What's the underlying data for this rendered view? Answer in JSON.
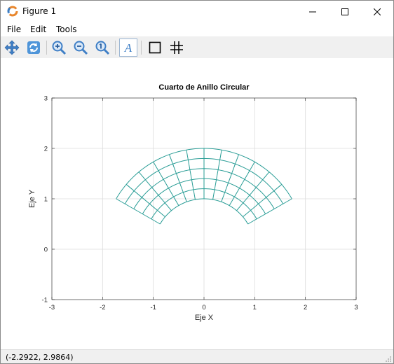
{
  "window": {
    "title": "Figure 1"
  },
  "menu": {
    "items": [
      "File",
      "Edit",
      "Tools"
    ]
  },
  "toolbar": {
    "buttons": [
      "pan-icon",
      "rotate-icon",
      "zoom-in-icon",
      "zoom-out-icon",
      "zoom-reset-icon",
      "insert-text-icon",
      "axes-box-icon",
      "grid-icon"
    ]
  },
  "status": {
    "coordinates": "(-2.2922, 2.9864)"
  },
  "colors": {
    "mesh": "#2a9d96",
    "grid": "#dcdcdc",
    "axes": "#262626"
  },
  "chart_data": {
    "type": "line",
    "title": "Cuarto de Anillo Circular",
    "xlabel": "Eje X",
    "ylabel": "Eje Y",
    "xlim": [
      -3,
      3
    ],
    "ylim": [
      -1,
      3
    ],
    "xticks": [
      "-3",
      "-2",
      "-1",
      "0",
      "1",
      "2",
      "3"
    ],
    "yticks": [
      "-1",
      "0",
      "1",
      "2",
      "3"
    ],
    "grid": true,
    "mesh": {
      "shape": "annular sector",
      "r_inner": 1.0,
      "r_outer": 2.0,
      "theta_start_deg": 30,
      "theta_end_deg": 150,
      "radial_divisions": 5,
      "angular_divisions": 12
    }
  }
}
